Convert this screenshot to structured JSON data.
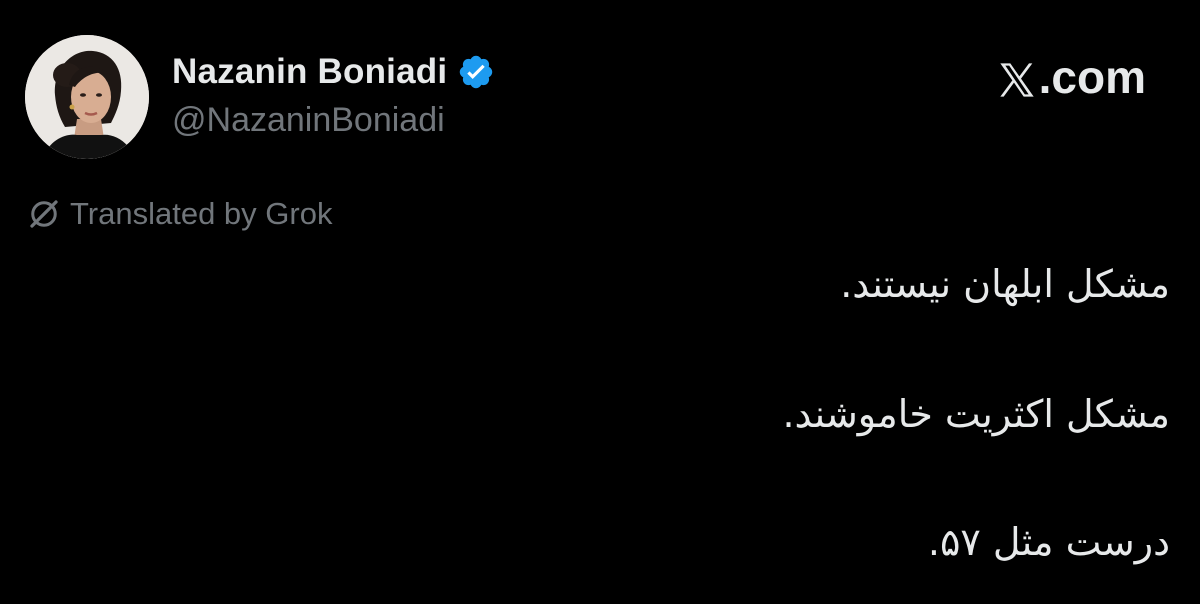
{
  "author": {
    "display_name": "Nazanin Boniadi",
    "handle": "@NazaninBoniadi",
    "verified": true,
    "verified_color": "#1d9bf0",
    "avatar_icon": "profile-photo"
  },
  "branding": {
    "site_label": ".com",
    "site_icon": "x-logo-icon"
  },
  "translation": {
    "label": "Translated by Grok",
    "icon": "grok-icon"
  },
  "tweet": {
    "lines": [
      "مشکل ابلهان نیستند.",
      "مشکل اکثریت خاموشند.",
      "درست مثل ۵۷."
    ]
  },
  "colors": {
    "background": "#000000",
    "primary_text": "#e7e9ea",
    "secondary_text": "#71767b"
  }
}
